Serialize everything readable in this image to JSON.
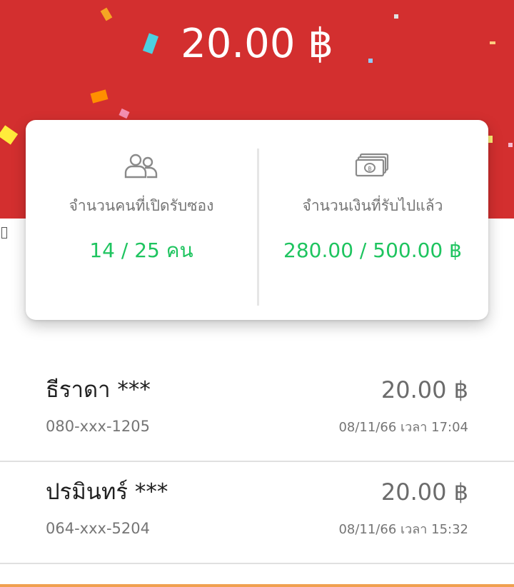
{
  "header": {
    "amount": "20.00 ฿",
    "bg_color": "#d32f2f"
  },
  "stats": {
    "opened": {
      "icon": "people-icon",
      "label": "จำนวนคนที่เปิดรับซอง",
      "value": "14 / 25 คน"
    },
    "received": {
      "icon": "banknote-icon",
      "label": "จำนวนเงินที่รับไปแล้ว",
      "value": "280.00 / 500.00 ฿"
    },
    "accent_color": "#1ec45f"
  },
  "transactions": [
    {
      "name": "ธีราดา ***",
      "amount": "20.00 ฿",
      "phone": "080-xxx-1205",
      "time": "08/11/66 เวลา 17:04"
    },
    {
      "name": "ปรมินทร์ ***",
      "amount": "20.00 ฿",
      "phone": "064-xxx-5204",
      "time": "08/11/66 เวลา 15:32"
    }
  ]
}
